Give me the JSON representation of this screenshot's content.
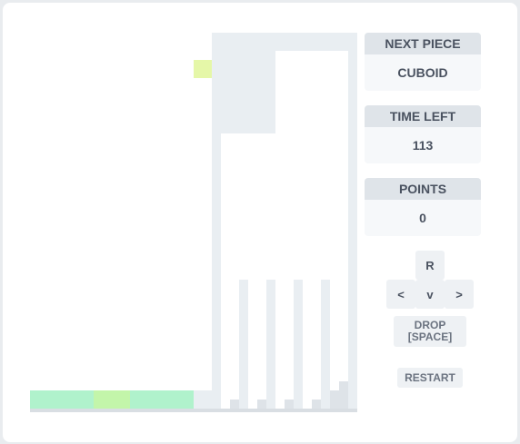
{
  "side": {
    "next_piece": {
      "label": "NEXT PIECE",
      "value": "CUBOID"
    },
    "time_left": {
      "label": "TIME LEFT",
      "value": "113"
    },
    "points": {
      "label": "POINTS",
      "value": "0"
    }
  },
  "controls": {
    "rotate": "R",
    "left": "<",
    "down": "v",
    "right": ">",
    "drop_line1": "DROP",
    "drop_line2": "[SPACE]",
    "restart": "RESTART"
  },
  "colors": {
    "mint": "#b0f2cc",
    "lime": "#c3f5aa",
    "yellow": "#e5f7a8",
    "frame": "#e9eef2",
    "floor": "#d9dee3",
    "stub": "#dee3e8"
  }
}
